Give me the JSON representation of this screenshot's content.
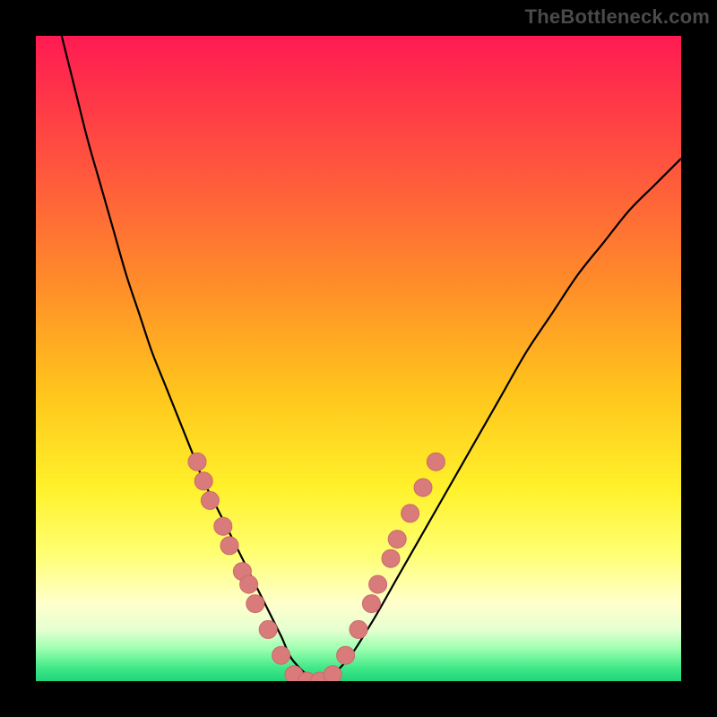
{
  "watermark": "TheBottleneck.com",
  "colors": {
    "background": "#000000",
    "curve": "#000000",
    "marker_fill": "#d97b7b",
    "marker_stroke": "#c96a6a"
  },
  "chart_data": {
    "type": "line",
    "title": "",
    "xlabel": "",
    "ylabel": "",
    "xlim": [
      0,
      100
    ],
    "ylim": [
      0,
      100
    ],
    "grid": false,
    "legend": false,
    "series": [
      {
        "name": "curve",
        "x": [
          4,
          6,
          8,
          10,
          12,
          14,
          16,
          18,
          20,
          22,
          24,
          26,
          28,
          30,
          32,
          34,
          36,
          38,
          40,
          44,
          48,
          52,
          56,
          60,
          64,
          68,
          72,
          76,
          80,
          84,
          88,
          92,
          96,
          100
        ],
        "y": [
          100,
          92,
          84,
          77,
          70,
          63,
          57,
          51,
          46,
          41,
          36,
          31,
          27,
          23,
          19,
          15,
          11,
          7,
          3,
          0,
          3,
          9,
          16,
          23,
          30,
          37,
          44,
          51,
          57,
          63,
          68,
          73,
          77,
          81
        ]
      }
    ],
    "markers": [
      {
        "x": 25,
        "y": 34
      },
      {
        "x": 26,
        "y": 31
      },
      {
        "x": 27,
        "y": 28
      },
      {
        "x": 29,
        "y": 24
      },
      {
        "x": 30,
        "y": 21
      },
      {
        "x": 32,
        "y": 17
      },
      {
        "x": 33,
        "y": 15
      },
      {
        "x": 34,
        "y": 12
      },
      {
        "x": 36,
        "y": 8
      },
      {
        "x": 38,
        "y": 4
      },
      {
        "x": 40,
        "y": 1
      },
      {
        "x": 42,
        "y": 0
      },
      {
        "x": 44,
        "y": 0
      },
      {
        "x": 46,
        "y": 1
      },
      {
        "x": 48,
        "y": 4
      },
      {
        "x": 50,
        "y": 8
      },
      {
        "x": 52,
        "y": 12
      },
      {
        "x": 53,
        "y": 15
      },
      {
        "x": 55,
        "y": 19
      },
      {
        "x": 56,
        "y": 22
      },
      {
        "x": 58,
        "y": 26
      },
      {
        "x": 60,
        "y": 30
      },
      {
        "x": 62,
        "y": 34
      }
    ]
  }
}
